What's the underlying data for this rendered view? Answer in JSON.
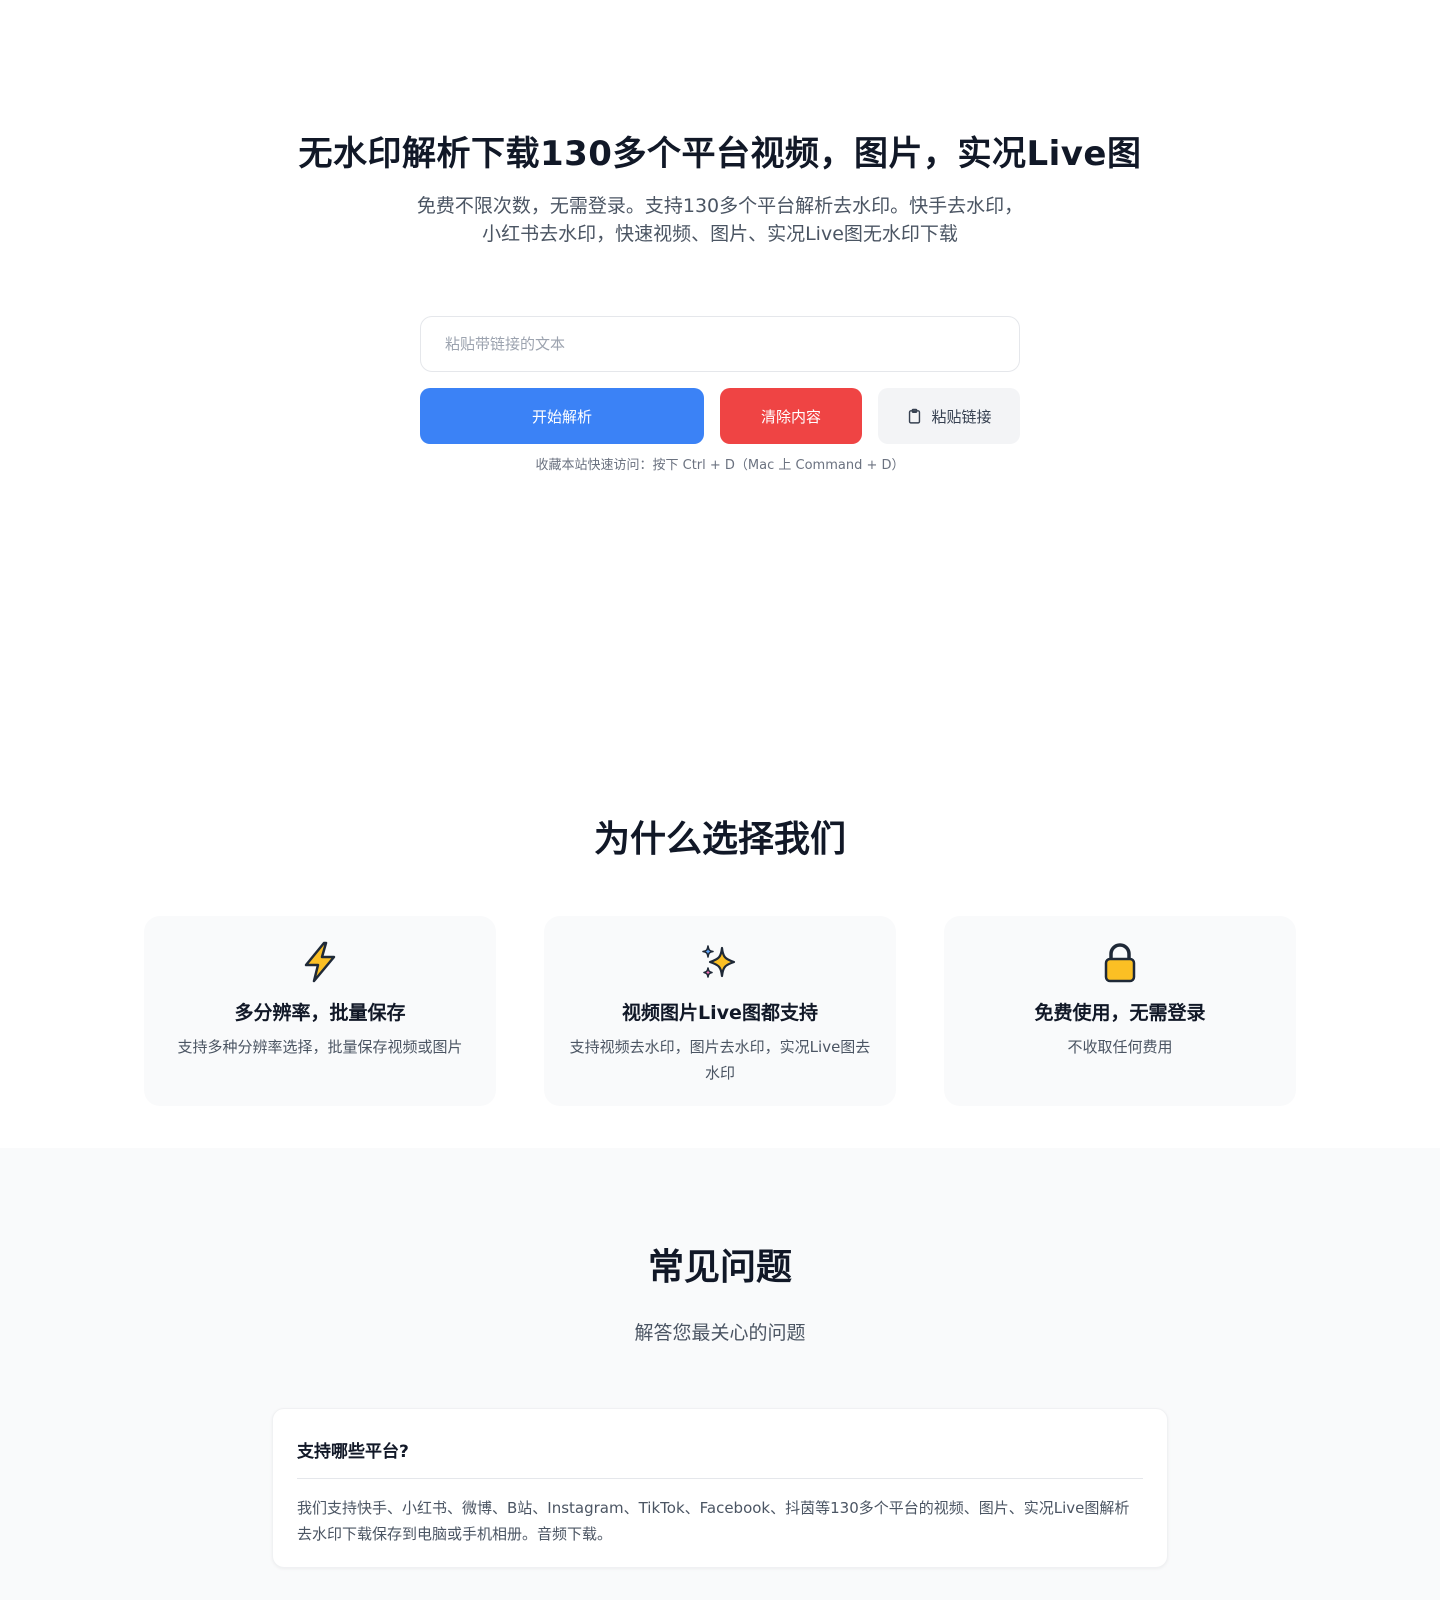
{
  "hero": {
    "title": "无水印解析下载130多个平台视频，图片，实况Live图",
    "subtitle": "免费不限次数，无需登录。支持130多个平台解析去水印。快手去水印，小红书去水印，快速视频、图片、实况Live图无水印下载"
  },
  "search": {
    "placeholder": "粘贴带链接的文本",
    "value": ""
  },
  "actions": {
    "parse_label": "开始解析",
    "clear_label": "清除内容",
    "paste_label": "粘贴链接",
    "paste_icon": "clipboard-icon"
  },
  "hint": "收藏本站快速访问：按下 Ctrl + D（Mac 上 Command + D）",
  "why": {
    "title": "为什么选择我们",
    "cards": [
      {
        "icon": "lightning-icon",
        "title": "多分辨率，批量保存",
        "desc": "支持多种分辨率选择，批量保存视频或图片"
      },
      {
        "icon": "sparkles-icon",
        "title": "视频图片Live图都支持",
        "desc": "支持视频去水印，图片去水印，实况Live图去水印"
      },
      {
        "icon": "lock-icon",
        "title": "免费使用，无需登录",
        "desc": "不收取任何费用"
      }
    ]
  },
  "faq": {
    "title": "常见问题",
    "subtitle": "解答您最关心的问题",
    "items": [
      {
        "question": "支持哪些平台?",
        "answer": "我们支持快手、小红书、微博、B站、Instagram、TikTok、Facebook、抖茵等130多个平台的视频、图片、实况Live图解析去水印下载保存到电脑或手机相册。音频下载。"
      }
    ]
  },
  "colors": {
    "primary": "#3b82f6",
    "danger": "#ef4444",
    "neutral_button": "#f3f4f6",
    "section_bg": "#f9fafb",
    "icon_yellow": "#fbbf24"
  }
}
